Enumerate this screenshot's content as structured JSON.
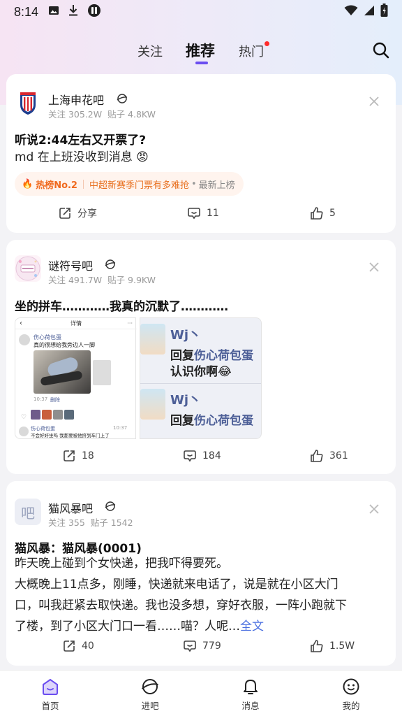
{
  "status_bar": {
    "time": "8:14",
    "left_icons": [
      "image-icon",
      "download-icon",
      "app-icon"
    ],
    "right_icons": [
      "wifi-icon",
      "signal-icon",
      "battery-icon"
    ]
  },
  "top_nav": {
    "tabs": [
      {
        "label": "关注",
        "active": false
      },
      {
        "label": "推荐",
        "active": true
      },
      {
        "label": "热门",
        "active": false,
        "badge_dot": true
      }
    ],
    "accent_color": "#6b4ef0",
    "dot_color": "#ff2b2b"
  },
  "posts": [
    {
      "forum_name": "上海申花吧",
      "followers_label": "关注 305.2W",
      "posts_label": "贴子 4.8KW",
      "title": "听说2:44左右又开票了?",
      "body": "md 在上班没收到消息",
      "body_emoji": "😡",
      "hot_tag": {
        "flame": "🔥",
        "rank": "热榜No.2",
        "topic": "中超新赛季门票有多难抢",
        "dot": "•",
        "board": "最新上榜"
      },
      "actions": {
        "share": "分享",
        "comments": "11",
        "likes": "5"
      }
    },
    {
      "forum_name": "谜符号吧",
      "followers_label": "关注 491.7W",
      "posts_label": "贴子 9.9KW",
      "title": "坐的拼车…………我真的沉默了…………",
      "image_left": {
        "header": "详情",
        "user": "伤心荷包蛋",
        "text": "真的很想给我旁边人一脚",
        "time": "10:37",
        "delete": "删除",
        "user2": "伤心荷包蛋",
        "time2": "10:37",
        "text2": "不会好好坐吗 我都要被他挤到车门上了"
      },
      "image_right": {
        "name1": "Wj丶",
        "reply_prefix": "回复",
        "reply_target": "伤心荷包蛋",
        "sub1": "认识你啊",
        "sub1_emoji": "😂",
        "name2": "Wj丶",
        "reply2_prefix": "回复",
        "reply2_target": "伤心荷包蛋"
      },
      "actions": {
        "shares": "18",
        "comments": "184",
        "likes": "361"
      }
    },
    {
      "forum_name": "猫风暴吧",
      "avatar_text": "吧",
      "followers_label": "关注 355",
      "posts_label": "贴子 1542",
      "title": "猫风暴：猫风暴(0001)",
      "body_lines": [
        "昨天晚上碰到个女快递，把我吓得要死。",
        "大概晚上11点多，刚睡，快递就来电话了，说是就在小区大门",
        "口，叫我赶紧去取快递。我也没多想，穿好衣服，一阵小跑就下",
        "了楼，到了小区大门口一看……喵？人呢…"
      ],
      "read_more": "全文",
      "read_more_color": "#4a6fe0",
      "actions": {
        "shares": "40",
        "comments": "779",
        "likes": "1.5W"
      }
    }
  ],
  "bottom_nav": [
    {
      "label": "首页",
      "icon": "home-icon",
      "active": true
    },
    {
      "label": "进吧",
      "icon": "planet-icon",
      "active": false
    },
    {
      "label": "消息",
      "icon": "bell-icon",
      "active": false
    },
    {
      "label": "我的",
      "icon": "smiley-icon",
      "active": false
    }
  ]
}
